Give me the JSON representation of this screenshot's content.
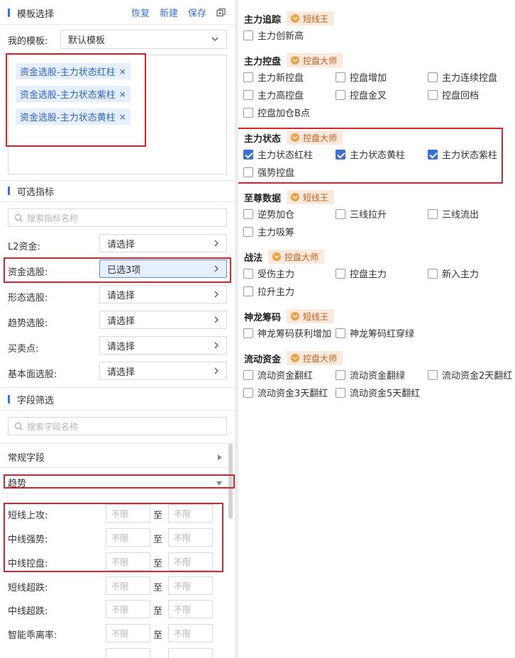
{
  "template": {
    "title": "模板选择",
    "actions": [
      "恢复",
      "新建",
      "保存"
    ],
    "my_template_label": "我的模板:",
    "my_template_value": "默认模板",
    "tags": [
      "资金选股-主力状态红柱",
      "资金选股-主力状态紫柱",
      "资金选股-主力状态黄柱"
    ]
  },
  "indicators": {
    "title": "可选指标",
    "search_placeholder": "搜索指标名称",
    "rows": [
      {
        "label": "L2资金:",
        "value": "请选择"
      },
      {
        "label": "资金选股:",
        "value": "已选3项"
      },
      {
        "label": "形态选股:",
        "value": "请选择"
      },
      {
        "label": "趋势选股:",
        "value": "请选择"
      },
      {
        "label": "买卖点:",
        "value": "请选择"
      },
      {
        "label": "基本面选股:",
        "value": "请选择"
      }
    ]
  },
  "fields": {
    "title": "字段筛选",
    "search_placeholder": "搜索字段名称",
    "groups": [
      "常规字段",
      "趋势"
    ],
    "range_placeholder": "不限",
    "to_label": "至",
    "ranges": [
      "短线上攻:",
      "中线强势:",
      "中线控盘:",
      "短线超跌:",
      "中线超跌:",
      "智能乖离率:"
    ]
  },
  "categories": [
    {
      "title": "主力追踪",
      "badge": "短线王",
      "items": [
        {
          "label": "主力创新高",
          "checked": false
        }
      ]
    },
    {
      "title": "主力控盘",
      "badge": "控盘大师",
      "items": [
        {
          "label": "主力新控盘",
          "checked": false
        },
        {
          "label": "控盘增加",
          "checked": false
        },
        {
          "label": "主力连续控盘",
          "checked": false
        },
        {
          "label": "主力高控盘",
          "checked": false
        },
        {
          "label": "控盘金叉",
          "checked": false
        },
        {
          "label": "控盘回档",
          "checked": false
        },
        {
          "label": "控盘加仓B点",
          "checked": false
        }
      ]
    },
    {
      "title": "主力状态",
      "badge": "控盘大师",
      "items": [
        {
          "label": "主力状态红柱",
          "checked": true
        },
        {
          "label": "主力状态黄柱",
          "checked": true
        },
        {
          "label": "主力状态紫柱",
          "checked": true
        },
        {
          "label": "强势控盘",
          "checked": false
        }
      ]
    },
    {
      "title": "至尊数据",
      "badge": "短线王",
      "items": [
        {
          "label": "逆势加仓",
          "checked": false
        },
        {
          "label": "三线拉升",
          "checked": false
        },
        {
          "label": "三线流出",
          "checked": false
        },
        {
          "label": "主力吸筹",
          "checked": false
        }
      ]
    },
    {
      "title": "战法",
      "badge": "控盘大师",
      "items": [
        {
          "label": "受伤主力",
          "checked": false
        },
        {
          "label": "控盘主力",
          "checked": false
        },
        {
          "label": "新入主力",
          "checked": false
        },
        {
          "label": "拉升主力",
          "checked": false
        }
      ]
    },
    {
      "title": "神龙筹码",
      "badge": "短线王",
      "items": [
        {
          "label": "神龙筹码获利增加",
          "checked": false
        },
        {
          "label": "神龙筹码红穿绿",
          "checked": false
        }
      ]
    },
    {
      "title": "流动资金",
      "badge": "控盘大师",
      "items": [
        {
          "label": "流动资金翻红",
          "checked": false
        },
        {
          "label": "流动资金翻绿",
          "checked": false
        },
        {
          "label": "流动资金2天翻红",
          "checked": false
        },
        {
          "label": "流动资金3天翻红",
          "checked": false
        },
        {
          "label": "流动资金5天翻红",
          "checked": false
        }
      ]
    }
  ],
  "colors": {
    "accent": "#3a6fd8",
    "highlight": "#d9242b",
    "badge_bg": "#fbe9de",
    "badge_text": "#c0601c"
  }
}
